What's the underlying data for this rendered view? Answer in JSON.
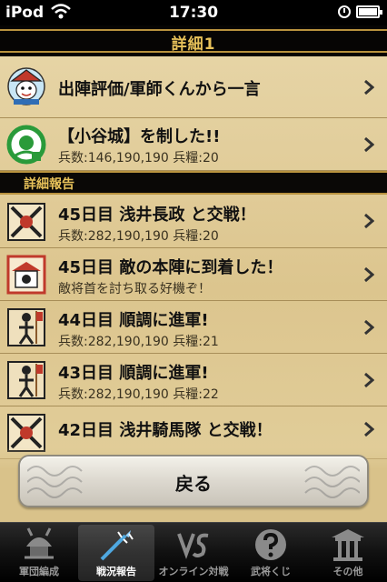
{
  "status_bar": {
    "carrier": "iPod",
    "time": "17:30"
  },
  "nav": {
    "title": "詳細1"
  },
  "summary_rows": [
    {
      "title": "出陣評価/軍師くんから一言",
      "subtitle": ""
    },
    {
      "title": "【小谷城】を制した!!",
      "subtitle": "兵数:146,190,190 兵糧:20"
    }
  ],
  "section": {
    "label": "詳細報告"
  },
  "report_rows": [
    {
      "title": "45日目 浅井長政 と交戦！",
      "subtitle": "兵数:282,190,190 兵糧:20",
      "icon": "crossed-swords-icon"
    },
    {
      "title": "45日目 敵の本陣に到着した！",
      "subtitle": "敵将首を討ち取る好機ぞ！",
      "icon": "enemy-camp-icon"
    },
    {
      "title": "44日目 順調に進軍!",
      "subtitle": "兵数:282,190,190 兵糧:21",
      "icon": "marching-soldier-icon"
    },
    {
      "title": "43日目 順調に進軍!",
      "subtitle": "兵数:282,190,190 兵糧:22",
      "icon": "marching-soldier-icon"
    },
    {
      "title": "42日目 浅井騎馬隊 と交戦！",
      "subtitle": "",
      "icon": "crossed-swords-icon"
    }
  ],
  "back_button": {
    "label": "戻る"
  },
  "tabs": [
    {
      "label": "軍団編成",
      "icon": "samurai-helmet-icon",
      "selected": false
    },
    {
      "label": "戦況報告",
      "icon": "spear-icon",
      "selected": true
    },
    {
      "label": "オンライン対戦",
      "icon": "vs-icon",
      "selected": false
    },
    {
      "label": "武将くじ",
      "icon": "question-icon",
      "selected": false
    },
    {
      "label": "その他",
      "icon": "shrine-icon",
      "selected": false
    }
  ],
  "colors": {
    "gold": "#e8c25a",
    "parchment": "#e3d09d",
    "trim": "#b8923e"
  }
}
